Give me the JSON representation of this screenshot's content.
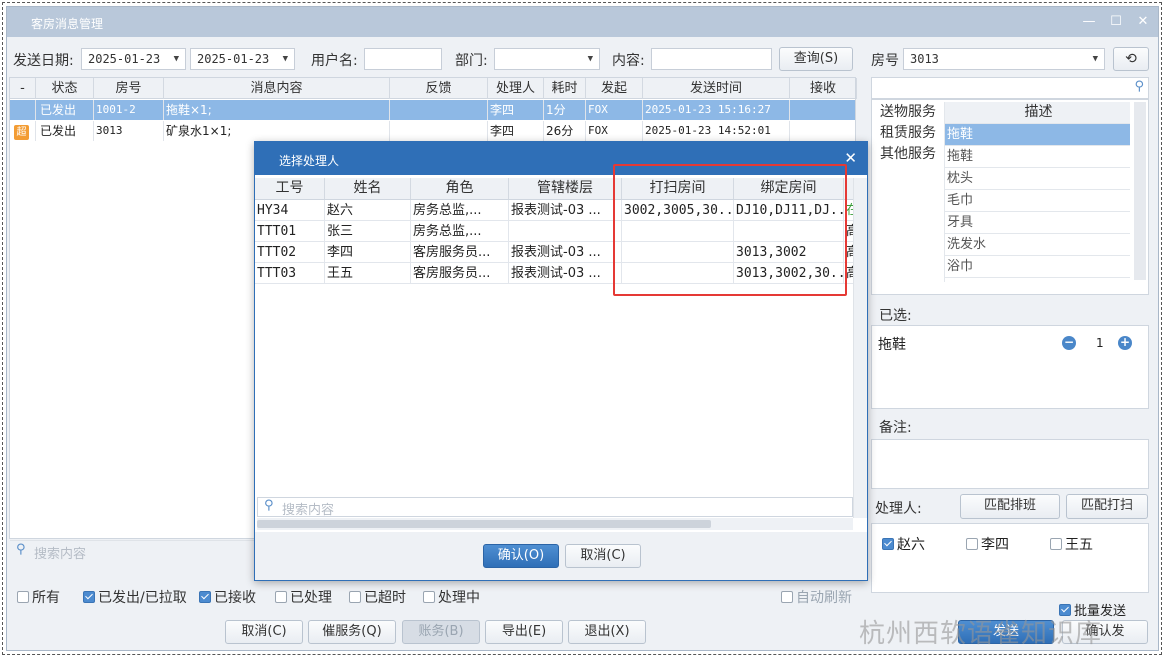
{
  "window": {
    "title": "客房消息管理"
  },
  "filters": {
    "send_date_label": "发送日期:",
    "date_from": "2025-01-23",
    "date_to": "2025-01-23",
    "username_label": "用户名:",
    "username_value": "",
    "dept_label": "部门:",
    "dept_value": "",
    "content_label": "内容:",
    "content_value": "",
    "query_button": "查询(S)"
  },
  "messages": {
    "columns": [
      "-",
      "状态",
      "房号",
      "消息内容",
      "反馈",
      "处理人",
      "耗时",
      "发起",
      "发送时间",
      "接收"
    ],
    "rows": [
      {
        "flag": "",
        "status": "已发出",
        "room": "1001-2",
        "content": "拖鞋×1;",
        "feedback": "",
        "handler": "李四",
        "duration": "1分",
        "origin": "FOX",
        "time": "2025-01-23 15:16:27"
      },
      {
        "flag": "超",
        "status": "已发出",
        "room": "3013",
        "content": "矿泉水1×1;",
        "feedback": "",
        "handler": "李四",
        "duration": "26分",
        "origin": "FOX",
        "time": "2025-01-23 14:52:01"
      }
    ],
    "search_placeholder": "搜索内容"
  },
  "status_filters": [
    {
      "label": "所有",
      "checked": false
    },
    {
      "label": "已发出/已拉取",
      "checked": true
    },
    {
      "label": "已接收",
      "checked": true
    },
    {
      "label": "已处理",
      "checked": false
    },
    {
      "label": "已超时",
      "checked": false
    },
    {
      "label": "处理中",
      "checked": false
    }
  ],
  "auto_refresh": "自动刷新",
  "bottom_buttons": {
    "cancel": "取消(C)",
    "urge": "催服务(Q)",
    "bill": "账务(B)",
    "export": "导出(E)",
    "exit": "退出(X)"
  },
  "dialog": {
    "title": "选择处理人",
    "columns": [
      "工号",
      "姓名",
      "角色",
      "管辖楼层",
      "打扫房间",
      "绑定房间"
    ],
    "rows": [
      {
        "id": "HY34",
        "name": "赵六",
        "role": "房务总监,...",
        "floor": "报表测试-03 ...",
        "clean": "3002,3005,30...",
        "bind": "DJ10,DJ11,DJ...",
        "extra": "在"
      },
      {
        "id": "TTT01",
        "name": "张三",
        "role": "房务总监,...",
        "floor": "",
        "clean": "",
        "bind": "",
        "extra": "高"
      },
      {
        "id": "TTT02",
        "name": "李四",
        "role": "客房服务员...",
        "floor": "报表测试-03 ...",
        "clean": "",
        "bind": "3013,3002",
        "extra": "高"
      },
      {
        "id": "TTT03",
        "name": "王五",
        "role": "客房服务员...",
        "floor": "报表测试-03 ...",
        "clean": "",
        "bind": "3013,3002,30...",
        "extra": "高"
      }
    ],
    "search_placeholder": "搜索内容",
    "confirm": "确认(O)",
    "cancel": "取消(C)",
    "highlight_color": "#e53935"
  },
  "right_panel": {
    "room_label": "房号",
    "room_value": "3013",
    "service_types": [
      "送物服务",
      "租赁服务",
      "其他服务"
    ],
    "desc_header": "描述",
    "items": [
      "拖鞋",
      "拖鞋",
      "枕头",
      "毛巾",
      "牙具",
      "洗发水",
      "浴巾"
    ],
    "selected_label": "已选:",
    "selected_item": "拖鞋",
    "selected_qty": "1",
    "remark_label": "备注:",
    "handler_label": "处理人:",
    "match_shift": "匹配排班",
    "match_clean": "匹配打扫",
    "handlers": [
      {
        "name": "赵六",
        "checked": true
      },
      {
        "name": "李四",
        "checked": false
      },
      {
        "name": "王五",
        "checked": false
      }
    ],
    "batch_send": "批量发送",
    "send_button": "发送",
    "confirm_button": "确认发"
  },
  "watermark": "杭州西软语雀知识库",
  "colors": {
    "accent": "#2f6fb7",
    "title_bar": "#b9c8da",
    "selected_row": "#8db8e6"
  }
}
